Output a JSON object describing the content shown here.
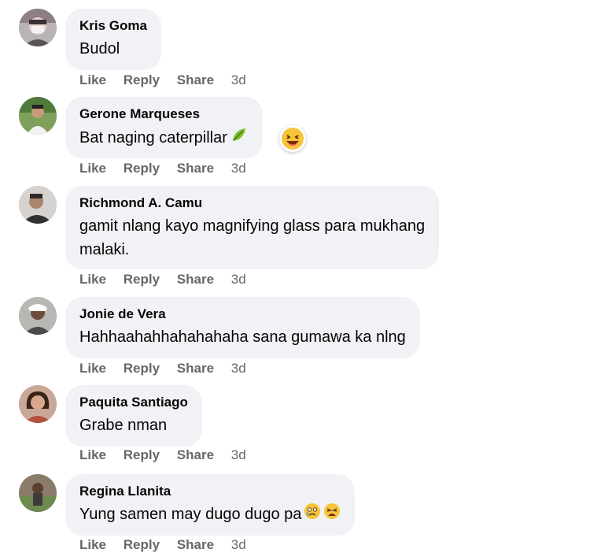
{
  "actions": {
    "like": "Like",
    "reply": "Reply",
    "share": "Share"
  },
  "comments": [
    {
      "name": "Kris Goma",
      "text": [
        "Budol"
      ],
      "time": "3d"
    },
    {
      "name": "Gerone Marqueses",
      "text": [
        "Bat naging caterpillar"
      ],
      "time": "3d",
      "emoji": [
        "leaf-caterpillar-icon"
      ],
      "reaction": "laughing-face-icon"
    },
    {
      "name": "Richmond A. Camu",
      "text": [
        "gamit nlang kayo magnifying glass para mukhang",
        "malaki."
      ],
      "time": "3d"
    },
    {
      "name": "Jonie de Vera",
      "text": [
        "Hahhaahahhahahahaha sana gumawa ka nlng"
      ],
      "time": "3d"
    },
    {
      "name": "Paquita Santiago",
      "text": [
        "Grabe nman"
      ],
      "time": "3d"
    },
    {
      "name": "Regina Llanita",
      "text": [
        "Yung samen may dugo dugo pa"
      ],
      "time": "3d",
      "emoji": [
        "crying-face-icon",
        "tired-face-icon"
      ]
    }
  ],
  "colors": {
    "bubble": "#f0f2f5",
    "action_text": "#65676b",
    "name_text": "#050505"
  }
}
